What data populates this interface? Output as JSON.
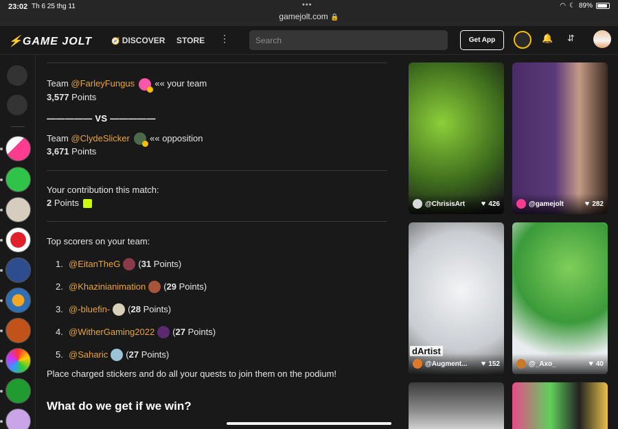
{
  "status_bar": {
    "time": "23:02",
    "date": "Th 6 25 thg 11",
    "url": "gamejolt.com",
    "battery": "89%",
    "battery_level": 0.89
  },
  "nav": {
    "logo": "GAME JOLT",
    "discover": "DISCOVER",
    "store": "STORE",
    "search_placeholder": "Search",
    "get_app": "Get App"
  },
  "main": {
    "team_label": "Team",
    "your_team_user": "@FarleyFungus",
    "your_team_note": "«« your team",
    "your_team_points": "3,577",
    "points_word": "Points",
    "vs_text": "————— VS —————",
    "opp_user": "@ClydeSlicker",
    "opp_note": "«« opposition",
    "opp_points": "3,671",
    "contribution_label": "Your contribution this match:",
    "contribution_points": "2",
    "top_scorers_label": "Top scorers on your team:",
    "scorers": [
      {
        "rank": "1.",
        "user": "@EitanTheG",
        "points": "31"
      },
      {
        "rank": "2.",
        "user": "@Khazinianimation",
        "points": "29"
      },
      {
        "rank": "3.",
        "user": "@-bluefin-",
        "points": "28"
      },
      {
        "rank": "4.",
        "user": "@WitherGaming2022",
        "points": "27"
      },
      {
        "rank": "5.",
        "user": "@Saharic",
        "points": "27"
      }
    ],
    "cta": "Place charged stickers and do all your quests to join them on the podium!",
    "what_win": "What do we get if we win?"
  },
  "feed": [
    {
      "user": "@ChrisisArt",
      "likes": "426"
    },
    {
      "user": "@gamejolt",
      "likes": "282"
    },
    {
      "user": "@Augment...",
      "likes": "152",
      "overlay": "dArtist"
    },
    {
      "user": "@_Axo_",
      "likes": "40"
    }
  ],
  "colors": {
    "background": "#191919",
    "link": "#e8a53c",
    "accent": "#ffbc00",
    "lime": "#ccff00"
  },
  "icons": [
    "lightning-logo-icon",
    "compass-icon",
    "more-vertical-icon",
    "trophy-badge-icon",
    "bell-icon",
    "quest-icon",
    "heart-icon",
    "library-icon",
    "verified-icon"
  ]
}
